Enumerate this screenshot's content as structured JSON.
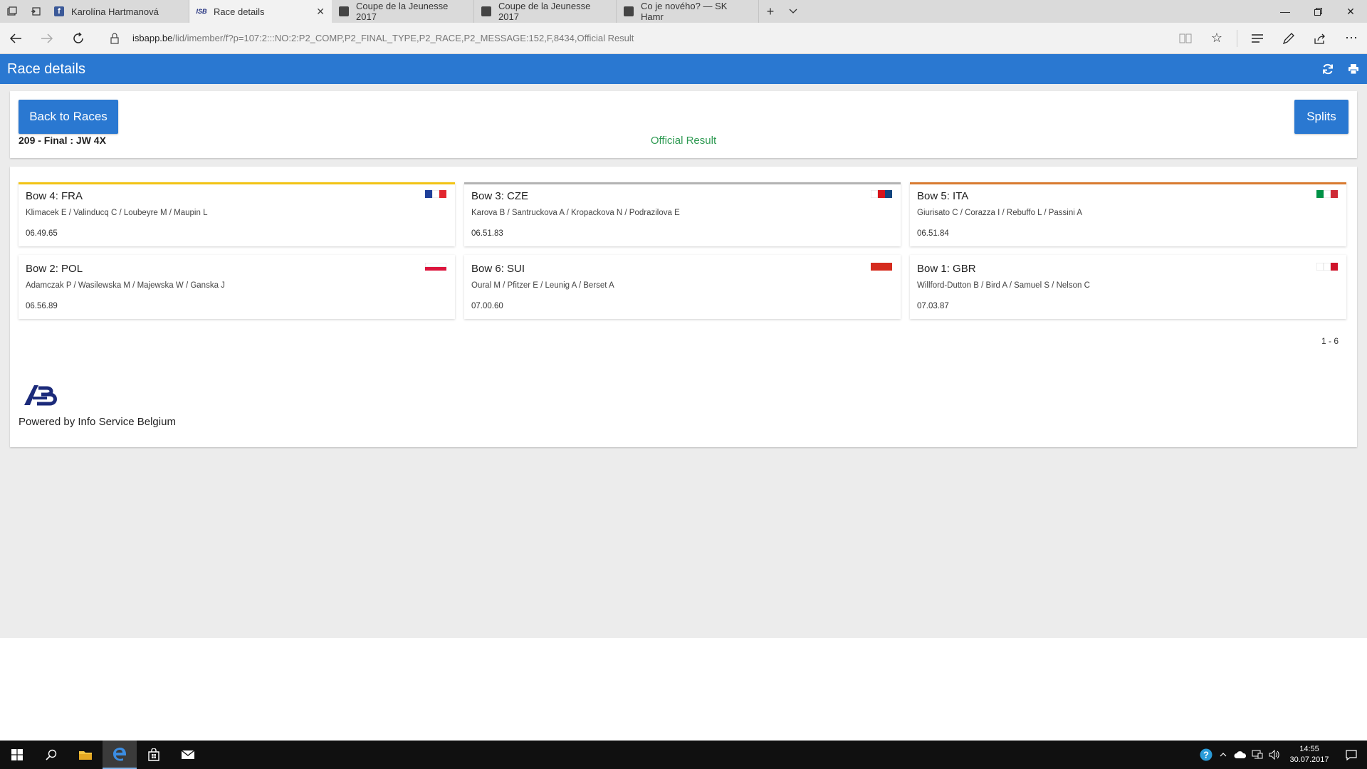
{
  "browser": {
    "tabs": [
      {
        "label": "Karolína Hartmanová",
        "icon": "facebook-icon"
      },
      {
        "label": "Race details",
        "icon": "isb-icon",
        "active": true
      },
      {
        "label": "Coupe de la Jeunesse 2017",
        "icon": "cube-icon"
      },
      {
        "label": "Coupe de la Jeunesse 2017",
        "icon": "cube-icon"
      },
      {
        "label": "Co je nového? — SK Hamr",
        "icon": "cube-icon"
      }
    ],
    "url_host": "isbapp.be",
    "url_path": "/lid/imember/f?p=107:2:::NO:2:P2_COMP,P2_FINAL_TYPE,P2_RACE,P2_MESSAGE:152,F,8434,Official Result"
  },
  "header": {
    "title": "Race details"
  },
  "race": {
    "back_label": "Back to Races",
    "splits_label": "Splits",
    "name": "209 - Final : JW 4X",
    "status": "Official Result"
  },
  "results": [
    {
      "bow": "Bow 4: FRA",
      "crew": "Klimacek E / Valinducq C / Loubeyre M / Maupin L",
      "time": "06.49.65",
      "medal_color": "#f2c314",
      "flag": [
        "#1f3f99",
        "#ffffff",
        "#e2262e"
      ]
    },
    {
      "bow": "Bow 3: CZE",
      "crew": "Karova B / Santruckova A / Kropackova N / Podrazilova E",
      "time": "06.51.83",
      "medal_color": "#b3b3b3",
      "flag": [
        "#ffffff",
        "#d7141a",
        "#11457e"
      ]
    },
    {
      "bow": "Bow 5: ITA",
      "crew": "Giurisato C / Corazza I / Rebuffo L / Passini A",
      "time": "06.51.84",
      "medal_color": "#d97a30",
      "flag": [
        "#009246",
        "#ffffff",
        "#ce2b37"
      ]
    },
    {
      "bow": "Bow 2: POL",
      "crew": "Adamczak P / Wasilewska M / Majewska W / Ganska J",
      "time": "06.56.89",
      "medal_color": "",
      "flag": [
        "#ffffff",
        "#dc143c"
      ]
    },
    {
      "bow": "Bow 6: SUI",
      "crew": "Oural M / Pfitzer E / Leunig A / Berset A",
      "time": "07.00.60",
      "medal_color": "",
      "flag": [
        "#d52b1e"
      ]
    },
    {
      "bow": "Bow 1: GBR",
      "crew": "Willford-Dutton B / Bird A / Samuel S / Nelson C",
      "time": "07.03.87",
      "medal_color": "",
      "flag": [
        "#ffffff",
        "#ffffff",
        "#cf142b"
      ]
    }
  ],
  "pager": "1 - 6",
  "footer": {
    "powered_by": "Powered by Info Service Belgium"
  },
  "taskbar": {
    "time": "14:55",
    "date": "30.07.2017"
  }
}
